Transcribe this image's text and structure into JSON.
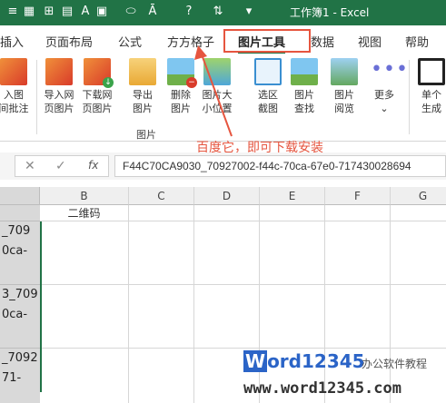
{
  "window": {
    "title": "工作簿1 - Excel"
  },
  "quick_access": [
    {
      "name": "menu-icon",
      "glyph": "≡"
    },
    {
      "name": "sheet-icon",
      "glyph": "▦"
    },
    {
      "name": "table-icon",
      "glyph": "⊞"
    },
    {
      "name": "clipboard-icon",
      "glyph": "▤"
    },
    {
      "name": "text-icon",
      "glyph": "A"
    },
    {
      "name": "shape-icon",
      "glyph": "▣"
    },
    {
      "name": "lasso-icon",
      "glyph": "⬭"
    },
    {
      "name": "textbox-icon",
      "glyph": "Ā"
    },
    {
      "name": "help-icon",
      "glyph": "?"
    },
    {
      "name": "sort-icon",
      "glyph": "⇅"
    },
    {
      "name": "dropdown-icon",
      "glyph": "▾"
    }
  ],
  "tabs": [
    "插入",
    "页面布局",
    "公式",
    "方方格子",
    "图片工具",
    "数据",
    "视图",
    "帮助"
  ],
  "active_tab": "图片工具",
  "ribbon": {
    "buttons": [
      {
        "name": "import-batch-button",
        "label": [
          "入图",
          "间批注"
        ],
        "icon": "ico-red"
      },
      {
        "name": "import-web-pic-button",
        "label": [
          "导入网",
          "页图片"
        ],
        "icon": "ico-red"
      },
      {
        "name": "download-web-pic-button",
        "label": [
          "下载网",
          "页图片"
        ],
        "icon": "ico-red-dl"
      },
      {
        "name": "export-pic-button",
        "label": [
          "导出",
          "图片"
        ],
        "icon": "ico-folder"
      },
      {
        "name": "delete-pic-button",
        "label": [
          "删除",
          "图片"
        ],
        "icon": "ico-pic-del"
      },
      {
        "name": "pic-size-button",
        "label": [
          "图片大",
          "小位置"
        ],
        "icon": "ico-resize"
      },
      {
        "name": "select-screenshot-button",
        "label": [
          "选区",
          "截图"
        ],
        "icon": "ico-select"
      },
      {
        "name": "pic-find-button",
        "label": [
          "图片",
          "查找"
        ],
        "icon": "ico-find"
      },
      {
        "name": "pic-browse-button",
        "label": [
          "图片",
          "阅览"
        ],
        "icon": "ico-browse"
      },
      {
        "name": "more-button",
        "label": [
          "更多",
          "⌄"
        ],
        "icon": "ico-more"
      },
      {
        "name": "single-generate-button",
        "label": [
          "单个",
          "生成"
        ],
        "icon": "ico-qr"
      }
    ],
    "group_label": "图片"
  },
  "annotation": {
    "text": "百度它，即可下载安装",
    "color": "#e6553f"
  },
  "formula_bar": {
    "cancel": "✕",
    "confirm": "✓",
    "fx": "fx",
    "value": "F44C70CA9030_70927002-f44c-70ca-67e0-717430028694"
  },
  "grid": {
    "columns": [
      "B",
      "C",
      "D",
      "E",
      "F",
      "G"
    ],
    "b1": "二维码",
    "colA_rows": [
      {
        "lines": "_709\n0ca-"
      },
      {
        "lines": "3_709\n0ca-"
      },
      {
        "lines": "_7092\n71-"
      }
    ]
  },
  "watermark": {
    "logo_w": "W",
    "logo_rest": "ord12345",
    "subtitle": "办公软件教程",
    "url": "www.word12345.com"
  }
}
